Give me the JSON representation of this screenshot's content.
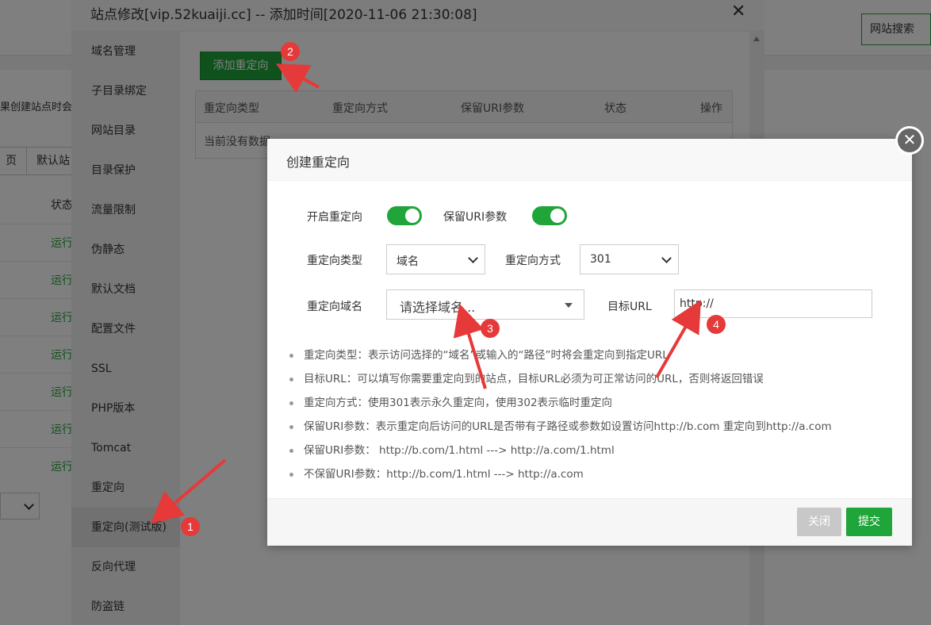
{
  "background": {
    "search_button": "网站搜索",
    "hint_text": "果创建站点时会",
    "btn_1": "页",
    "btn_2": "默认站",
    "status_col": "状态",
    "status_values": [
      "运行",
      "运行",
      "运行",
      "运行",
      "运行",
      "运行",
      "运行"
    ]
  },
  "outer_modal": {
    "title": "站点修改[vip.52kuaiji.cc] -- 添加时间[2020-11-06 21:30:08]",
    "close": "✕",
    "nav": [
      "域名管理",
      "子目录绑定",
      "网站目录",
      "目录保护",
      "流量限制",
      "伪静态",
      "默认文档",
      "配置文件",
      "SSL",
      "PHP版本",
      "Tomcat",
      "重定向",
      "重定向(测试版)",
      "反向代理",
      "防盗链"
    ],
    "active_nav_index": 12,
    "add_button": "添加重定向",
    "table": {
      "headers": [
        "重定向类型",
        "重定向方式",
        "保留URI参数",
        "状态",
        "操作"
      ],
      "empty_text": "当前没有数据"
    }
  },
  "dialog": {
    "title": "创建重定向",
    "close": "✕",
    "enable_label": "开启重定向",
    "enable_on": true,
    "keep_uri_label": "保留URI参数",
    "keep_uri_on": true,
    "type_label": "重定向类型",
    "type_value": "域名",
    "method_label": "重定向方式",
    "method_value": "301",
    "domain_label": "重定向域名",
    "domain_placeholder": "请选择域名...",
    "target_label": "目标URL",
    "target_value": "http://",
    "help": [
      "重定向类型：表示访问选择的“域名”或输入的“路径”时将会重定向到指定URL",
      "目标URL：可以填写你需要重定向到的站点，目标URL必须为可正常访问的URL，否则将返回错误",
      "重定向方式：使用301表示永久重定向，使用302表示临时重定向",
      "保留URI参数：表示重定向后访问的URL是否带有子路径或参数如设置访问http://b.com 重定向到http://a.com",
      "保留URI参数：  http://b.com/1.html ---> http://a.com/1.html",
      "不保留URI参数：http://b.com/1.html ---> http://a.com"
    ],
    "close_button": "关闭",
    "submit_button": "提交"
  },
  "annotations": [
    "1",
    "2",
    "3",
    "4"
  ],
  "colors": {
    "accent": "#20a53a",
    "annotation": "#e63939"
  }
}
